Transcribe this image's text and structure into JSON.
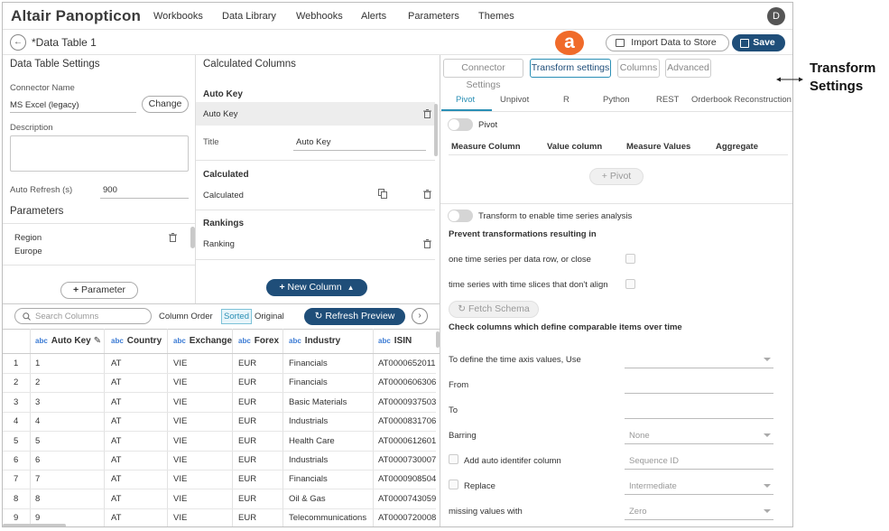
{
  "app": {
    "logo": "Altair Panopticon",
    "avatar": "D"
  },
  "nav": [
    "Workbooks",
    "Data Library",
    "Webhooks",
    "Alerts",
    "Parameters",
    "Themes"
  ],
  "titlebar": {
    "back": "←",
    "title": "*Data Table 1",
    "import_label": "Import Data to Store",
    "save_label": "Save",
    "marker": "a"
  },
  "settings": {
    "heading": "Data Table Settings",
    "connector_label": "Connector Name",
    "connector_value": "MS Excel (legacy)",
    "change_label": "Change",
    "description_label": "Description",
    "auto_refresh_label": "Auto Refresh (s)",
    "auto_refresh_value": "900",
    "parameters_heading": "Parameters",
    "param_name": "Region",
    "param_value": "Europe",
    "add_parameter": "Parameter"
  },
  "calc": {
    "heading": "Calculated Columns",
    "auto_key_heading": "Auto Key",
    "auto_key_item": "Auto Key",
    "title_label": "Title",
    "title_value": "Auto Key",
    "calculated_heading": "Calculated",
    "calculated_item": "Calculated",
    "rankings_heading": "Rankings",
    "rankings_item": "Ranking",
    "new_column": "New Column"
  },
  "preview": {
    "search_placeholder": "Search Columns",
    "column_order_label": "Column Order",
    "sorted_label": "Sorted",
    "original_label": "Original",
    "refresh_label": "Refresh Preview",
    "columns": [
      {
        "type": "abc",
        "name": "Auto Key"
      },
      {
        "type": "abc",
        "name": "Country"
      },
      {
        "type": "abc",
        "name": "Exchange"
      },
      {
        "type": "abc",
        "name": "Forex"
      },
      {
        "type": "abc",
        "name": "Industry"
      },
      {
        "type": "abc",
        "name": "ISIN"
      }
    ],
    "rows": [
      [
        "1",
        "1",
        "AT",
        "VIE",
        "EUR",
        "Financials",
        "AT0000652011"
      ],
      [
        "2",
        "2",
        "AT",
        "VIE",
        "EUR",
        "Financials",
        "AT0000606306"
      ],
      [
        "3",
        "3",
        "AT",
        "VIE",
        "EUR",
        "Basic Materials",
        "AT0000937503"
      ],
      [
        "4",
        "4",
        "AT",
        "VIE",
        "EUR",
        "Industrials",
        "AT0000831706"
      ],
      [
        "5",
        "5",
        "AT",
        "VIE",
        "EUR",
        "Health Care",
        "AT0000612601"
      ],
      [
        "6",
        "6",
        "AT",
        "VIE",
        "EUR",
        "Industrials",
        "AT0000730007"
      ],
      [
        "7",
        "7",
        "AT",
        "VIE",
        "EUR",
        "Financials",
        "AT0000908504"
      ],
      [
        "8",
        "8",
        "AT",
        "VIE",
        "EUR",
        "Oil & Gas",
        "AT0000743059"
      ],
      [
        "9",
        "9",
        "AT",
        "VIE",
        "EUR",
        "Telecommunications",
        "AT0000720008"
      ]
    ]
  },
  "transform": {
    "top_tabs": [
      "Connector Settings",
      "Transform settings",
      "Columns",
      "Advanced"
    ],
    "sub_tabs": [
      "Pivot",
      "Unpivot",
      "R",
      "Python",
      "REST",
      "Orderbook Reconstruction"
    ],
    "pivot_toggle": "Pivot",
    "pivot_headers": [
      "Measure Column",
      "Value column",
      "Measure Values",
      "Aggregate"
    ],
    "pivot_button": "Pivot",
    "timeseries_toggle": "Transform to enable time series analysis",
    "prevent_heading": "Prevent transformations resulting in",
    "prevent_1": "one time series per data row, or close",
    "prevent_2": "time series with time slices that don't align",
    "fetch_schema": "Fetch Schema",
    "check_heading": "Check columns which define comparable items over time",
    "time_axis_label": "To define the time axis values, Use",
    "from_label": "From",
    "to_label": "To",
    "barring_label": "Barring",
    "barring_value": "None",
    "auto_id_label": "Add auto identifer column",
    "auto_id_value": "Sequence ID",
    "replace_label": "Replace",
    "replace_value": "Intermediate",
    "missing_label": "missing values with",
    "missing_value": "Zero"
  },
  "callout": {
    "line1": "Transform",
    "line2": "Settings"
  },
  "colors": {
    "accent": "#1f4e79",
    "marker": "#f06b2a",
    "tab_active": "#2a8fb5"
  }
}
